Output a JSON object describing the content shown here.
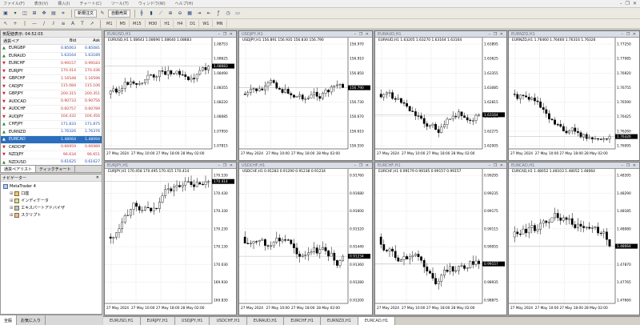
{
  "menu": [
    "ファイル(F)",
    "表示(V)",
    "挿入(I)",
    "チャート(C)",
    "ツール(T)",
    "ウィンドウ(W)",
    "ヘルプ(H)"
  ],
  "toolbar": {
    "new_order": "新規注文",
    "auto_trade": "自動売買"
  },
  "timeframes": [
    "M1",
    "M5",
    "M15",
    "M30",
    "H1",
    "H4",
    "D1",
    "W1",
    "MN"
  ],
  "market_watch": {
    "title": "気配値表示: 04:52:03",
    "col_symbol": "通貨ペア",
    "col_bid": "Bid",
    "col_ask": "Ask",
    "rows": [
      {
        "symbol": "EURGBP",
        "bid": "0.85063",
        "ask": "0.85081",
        "dir": "up"
      },
      {
        "symbol": "EURAUD",
        "bid": "1.63164",
        "ask": "1.63189",
        "dir": "up"
      },
      {
        "symbol": "EURCHF",
        "bid": "0.99157",
        "ask": "0.99183",
        "dir": "down"
      },
      {
        "symbol": "EURJPY",
        "bid": "170.414",
        "ask": "170.436",
        "dir": "down"
      },
      {
        "symbol": "GBPCHF",
        "bid": "1.16548",
        "ask": "1.16596",
        "dir": "down"
      },
      {
        "symbol": "CADJPY",
        "bid": "115.084",
        "ask": "115.106",
        "dir": "down"
      },
      {
        "symbol": "GBPJPY",
        "bid": "200.315",
        "ask": "200.351",
        "dir": "down"
      },
      {
        "symbol": "AUDCAD",
        "bid": "0.90733",
        "ask": "0.90756",
        "dir": "down"
      },
      {
        "symbol": "AUDCHF",
        "bid": "0.60757",
        "ask": "0.60789",
        "dir": "down"
      },
      {
        "symbol": "AUDJPY",
        "bid": "104.432",
        "ask": "104.456",
        "dir": "down"
      },
      {
        "symbol": "CHFJPY",
        "bid": "171.833",
        "ask": "171.875",
        "dir": "up"
      },
      {
        "symbol": "EURNZD",
        "bid": "1.76326",
        "ask": "1.76376",
        "dir": "up"
      },
      {
        "symbol": "EURCAD",
        "bid": "1.48064",
        "ask": "1.48094",
        "dir": "up",
        "selected": true
      },
      {
        "symbol": "CADCHF",
        "bid": "0.66959",
        "ask": "0.66989",
        "dir": "down"
      },
      {
        "symbol": "NZDJPY",
        "bid": "96.634",
        "ask": "96.651",
        "dir": "down"
      },
      {
        "symbol": "NZDUSD",
        "bid": "0.61625",
        "ask": "0.61627",
        "dir": "up"
      }
    ],
    "tabs": [
      "通貨ペアリスト",
      "ティックチャート"
    ]
  },
  "navigator": {
    "title": "ナビゲーター",
    "root": "MetaTrader 4",
    "items": [
      "口座",
      "インディケータ",
      "エキスパートアドバイザ",
      "スクリプト"
    ],
    "tabs": [
      "全般",
      "お気に入り"
    ]
  },
  "charts": [
    {
      "title": "EURUSD,H1",
      "info": "EURUSD,H1  1.08643 1.08696 1.08640 1.08683",
      "price_label": "1.08683",
      "axis": [
        "1.08753",
        "1.08625",
        "1.08490",
        "1.08355",
        "1.08220",
        "1.08085",
        "1.07950",
        "1.07815"
      ],
      "xlabels": [
        "27 May 2024",
        "27 May 10:00",
        "27 May 18:00",
        "28 May 02:00"
      ],
      "trend": "up",
      "seed": 3
    },
    {
      "title": "USDJPY,H1",
      "info": "USDJPY,H1  156.891 156.935 156.830 156.790",
      "price_label": "156.790",
      "axis": [
        "156.970",
        "156.910",
        "156.850",
        "156.790",
        "156.730",
        "156.670",
        "156.610",
        "156.550"
      ],
      "xlabels": [
        "27 May 2024",
        "27 May 10:00",
        "27 May 18:00",
        "28 May 02:00"
      ],
      "trend": "mixed",
      "seed": 7
    },
    {
      "title": "EURAUD,H1",
      "info": "EURAUD,H1  1.63205 1.63270 1.63164 1.63164",
      "price_label": "1.63164",
      "axis": [
        "1.63895",
        "1.63625",
        "1.63355",
        "1.63085",
        "1.62815",
        "1.62545",
        "1.62275",
        "1.62005"
      ],
      "xlabels": [
        "27 May 2024",
        "27 May 10:00",
        "27 May 18:00",
        "28 May 02:00"
      ],
      "trend": "downup",
      "seed": 11
    },
    {
      "title": "EURNZD,H1",
      "info": "EURNZD,H1  1.76460 1.76460 1.76316 1.76326",
      "price_label": "1.76326",
      "axis": [
        "1.77250",
        "1.77085",
        "1.76920",
        "1.76755",
        "1.76590",
        "1.76425",
        "1.76260",
        "1.76095"
      ],
      "xlabels": [
        "27 May 2024",
        "27 May 10:00",
        "27 May 18:00",
        "28 May 02:00"
      ],
      "trend": "down",
      "seed": 5
    },
    {
      "title": "EURJPY,H1",
      "info": "EURJPY,H1  170.458 170.495 170.415 170.414",
      "price_label": "170.414",
      "axis": [
        "170.530",
        "170.430",
        "170.330",
        "170.230",
        "170.130",
        "170.030",
        "169.930",
        "169.830"
      ],
      "xlabels": [
        "27 May 2024",
        "27 May 10:00",
        "27 May 18:00",
        "28 May 02:00"
      ],
      "trend": "up",
      "seed": 13
    },
    {
      "title": "USDCHF,H1",
      "info": "USDCHF,H1  0.91283 0.91290 0.91238 0.91234",
      "price_label": "0.91234",
      "axis": [
        "0.91760",
        "0.91680",
        "0.91600",
        "0.91520",
        "0.91440",
        "0.91360",
        "0.91280",
        "0.91200"
      ],
      "xlabels": [
        "27 May 2024",
        "27 May 10:00",
        "27 May 18:00",
        "28 May 02:00"
      ],
      "trend": "down",
      "seed": 17
    },
    {
      "title": "EURCHF,H1",
      "info": "EURCHF,H1  0.99179 0.99185 0.99157 0.99157",
      "price_label": "0.99157",
      "axis": [
        "0.99295",
        "0.99235",
        "0.99175",
        "0.99115",
        "0.99055",
        "0.98995",
        "0.98935",
        "0.98875"
      ],
      "xlabels": [
        "27 May 2024",
        "27 May 10:00",
        "27 May 18:00",
        "28 May 02:00"
      ],
      "trend": "downup",
      "seed": 19
    },
    {
      "title": "EURCAD,H1",
      "info": "EURCAD,H1  1.48052 1.48103 1.48052 1.48064",
      "price_label": "1.48064",
      "axis": [
        "1.48395",
        "1.48290",
        "1.48185",
        "1.48080",
        "1.47975",
        "1.47870",
        "1.47765",
        "1.47660"
      ],
      "xlabels": [
        "27 May 2024",
        "27 May 10:00",
        "27 May 18:00",
        "28 May 02:00"
      ],
      "trend": "downend",
      "seed": 23
    }
  ],
  "chart_tabs": [
    "EURUSD,H1",
    "EURJPY,H1",
    "USDJPY,H1",
    "USDCHF,H1",
    "EURAUD,H1",
    "EURCHF,H1",
    "EURNZD,H1",
    "EURCAD,H1"
  ],
  "active_chart_tab": "EURCAD,H1"
}
